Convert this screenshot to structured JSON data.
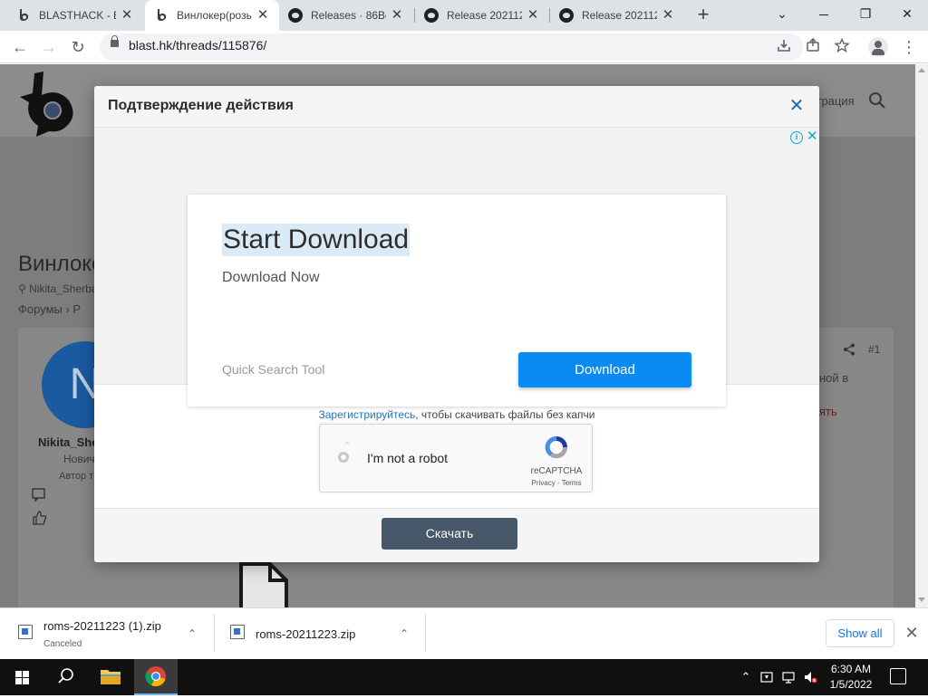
{
  "browser": {
    "tabs": [
      {
        "title": "BLASTHACK - Ex",
        "icon": "blasthack-favicon"
      },
      {
        "title": "Винлокер(розы",
        "icon": "blasthack-favicon",
        "active": true
      },
      {
        "title": "Releases · 86Bo",
        "icon": "github-icon"
      },
      {
        "title": "Release 202112",
        "icon": "github-icon"
      },
      {
        "title": "Release 202112",
        "icon": "github-icon"
      }
    ],
    "tab_close": "✕",
    "new_tab": "+",
    "window_controls": {
      "minimize": "⌄",
      "restore": "❐",
      "close": "✕"
    },
    "nav": {
      "back": "←",
      "forward": "→",
      "reload": "↻"
    },
    "url": "blast.hk/threads/115876/",
    "kebab": "⋮"
  },
  "page_behind": {
    "thread_title": "Винлокер",
    "author_meta": "Nikita_Sherba",
    "breadcrumb": "Форумы  ›  Р",
    "header_right": "страция",
    "user_name": "Nikita_She",
    "user_rank": "Нович",
    "author_label": "Автор т",
    "avatar_letter": "N",
    "post_number": "#1",
    "post_snippet": "ной в",
    "post_link": "ять"
  },
  "modal": {
    "title": "Подтверждение действия",
    "close": "✕",
    "ad": {
      "title": "Start Download",
      "subtitle": "Download Now",
      "brand": "Quick Search Tool",
      "button": "Download",
      "info": "i",
      "close": "✕"
    },
    "register_link": "Зарегистрируйтесь",
    "register_rest": ", чтобы скачивать файлы без капчи",
    "captcha": {
      "label": "I'm not a robot",
      "brand": "reCAPTCHA",
      "terms": "Privacy - Terms"
    },
    "download_button": "Скачать"
  },
  "downloads": {
    "items": [
      {
        "name": "roms-20211223 (1).zip",
        "status": "Canceled"
      },
      {
        "name": "roms-20211223.zip",
        "status": ""
      }
    ],
    "chevron": "⌃",
    "show_all": "Show all",
    "close": "✕"
  },
  "taskbar": {
    "time": "6:30 AM",
    "date": "1/5/2022"
  }
}
